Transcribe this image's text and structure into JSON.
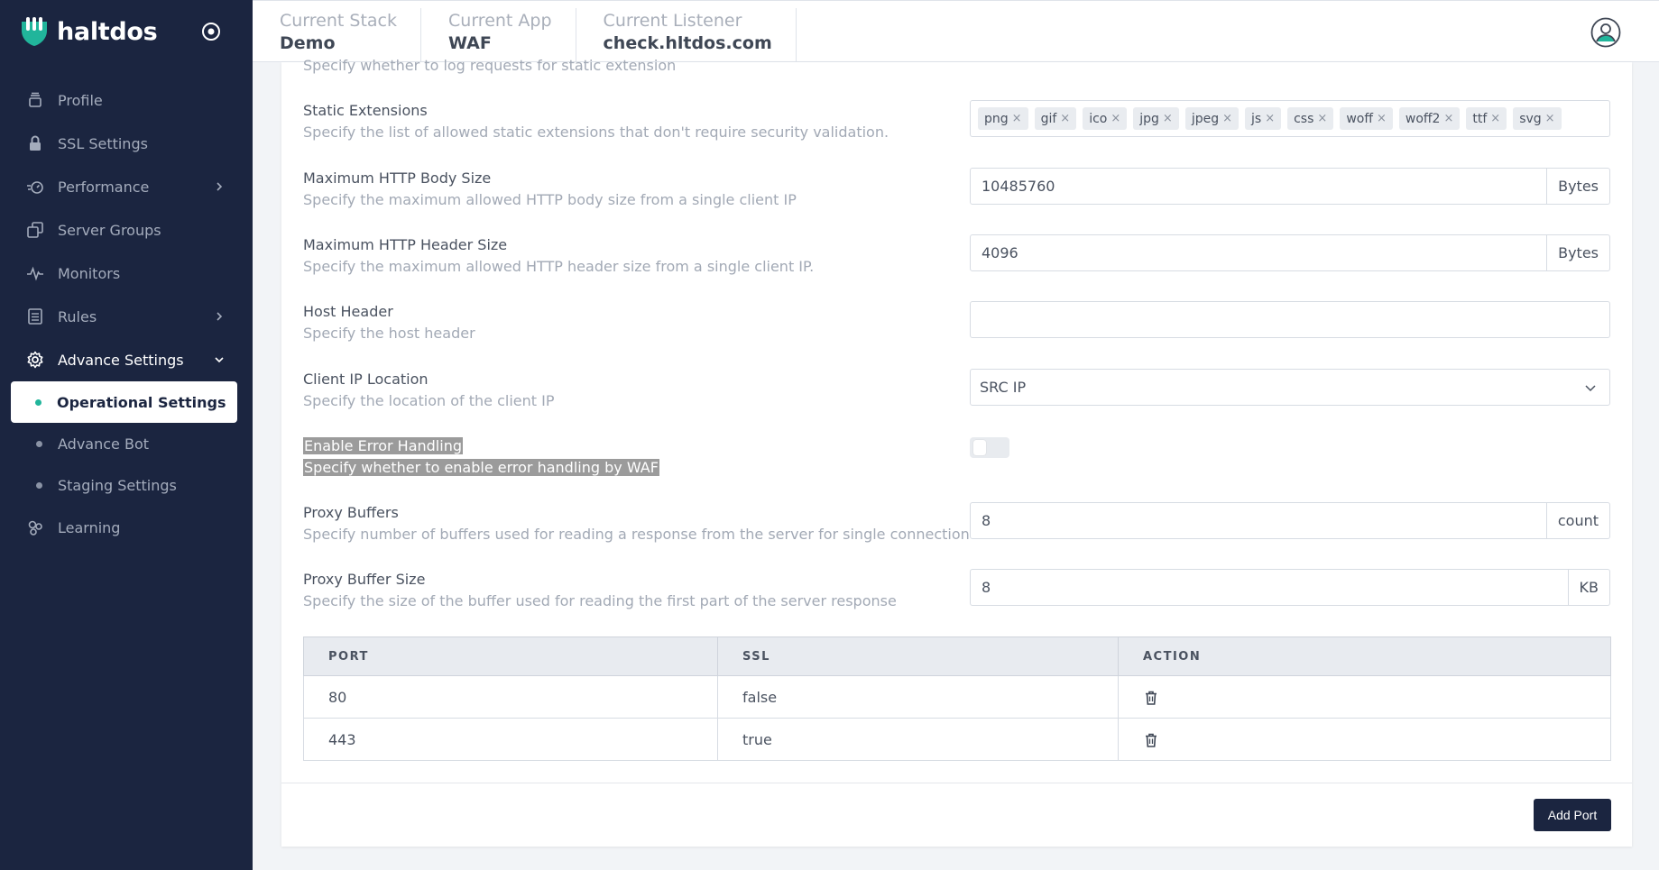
{
  "brand": {
    "name": "haltdos"
  },
  "sidebar": {
    "items": [
      {
        "label": "Profile"
      },
      {
        "label": "SSL Settings"
      },
      {
        "label": "Performance"
      },
      {
        "label": "Server Groups"
      },
      {
        "label": "Monitors"
      },
      {
        "label": "Rules"
      },
      {
        "label": "Advance Settings"
      }
    ],
    "subitems": [
      {
        "label": "Operational Settings"
      },
      {
        "label": "Advance Bot"
      },
      {
        "label": "Staging Settings"
      }
    ],
    "learning": {
      "label": "Learning"
    }
  },
  "header": {
    "crumbs": [
      {
        "label": "Current Stack",
        "value": "Demo"
      },
      {
        "label": "Current App",
        "value": "WAF"
      },
      {
        "label": "Current Listener",
        "value": "check.hltdos.com"
      }
    ]
  },
  "form": {
    "cut_top": {
      "desc": "Specify whether to log requests for static extension"
    },
    "static_ext": {
      "title": "Static Extensions",
      "desc": "Specify the list of allowed static extensions that don't require security validation.",
      "tags": [
        "png",
        "gif",
        "ico",
        "jpg",
        "jpeg",
        "js",
        "css",
        "woff",
        "woff2",
        "ttf",
        "svg"
      ]
    },
    "body_size": {
      "title": "Maximum HTTP Body Size",
      "desc": "Specify the maximum allowed HTTP body size from a single client IP",
      "value": "10485760",
      "unit": "Bytes"
    },
    "header_size": {
      "title": "Maximum HTTP Header Size",
      "desc": "Specify the maximum allowed HTTP header size from a single client IP.",
      "value": "4096",
      "unit": "Bytes"
    },
    "host_header": {
      "title": "Host Header",
      "desc": "Specify the host header",
      "value": ""
    },
    "client_ip": {
      "title": "Client IP Location",
      "desc": "Specify the location of the client IP",
      "value": "SRC IP"
    },
    "error_handling": {
      "title": "Enable Error Handling",
      "desc": "Specify whether to enable error handling by WAF",
      "enabled": false
    },
    "proxy_buffers": {
      "title": "Proxy Buffers",
      "desc": "Specify number of buffers used for reading a response from the server for single connection",
      "value": "8",
      "unit": "count"
    },
    "proxy_buffer_size": {
      "title": "Proxy Buffer Size",
      "desc": "Specify the size of the buffer used for reading the first part of the server response",
      "value": "8",
      "unit": "KB"
    }
  },
  "ports_table": {
    "headers": [
      "PORT",
      "SSL",
      "ACTION"
    ],
    "rows": [
      {
        "port": "80",
        "ssl": "false"
      },
      {
        "port": "443",
        "ssl": "true"
      }
    ]
  },
  "actions": {
    "add_port": "Add Port"
  }
}
